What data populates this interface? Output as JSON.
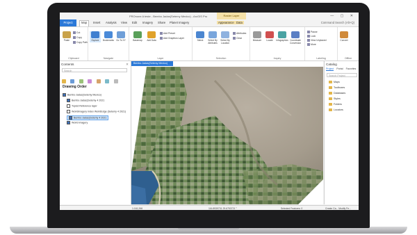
{
  "window": {
    "title": "PROnone A teste - Bembo Jadas(Setemy Mexico) - ArcGIS Pro",
    "contextual_group": "Raster Layer",
    "controls": "— ▢ ✕"
  },
  "ribbon_tabs": {
    "project": "Project",
    "tabs": [
      "Map",
      "Insert",
      "Analysis",
      "View",
      "Edit",
      "Imagery",
      "Share",
      "Planet Imagery",
      "Appearance",
      "Data"
    ],
    "active": "Map",
    "sign_in": "Command Search (Alt+Q)"
  },
  "ribbon": {
    "groups": [
      {
        "label": "Clipboard",
        "buttons": [
          "Paste",
          "Cut",
          "Copy",
          "Copy Path"
        ]
      },
      {
        "label": "Navigate",
        "buttons": [
          "Explore",
          "Bookmarks",
          "Go To XY"
        ]
      },
      {
        "label": "Layer",
        "buttons": [
          "Basemap",
          "Add Data",
          "Add Preset",
          "Add Graphics Layer"
        ]
      },
      {
        "label": "Selection",
        "buttons": [
          "Select",
          "Select By Attributes",
          "Select By Location",
          "Attributes",
          "Clear"
        ]
      },
      {
        "label": "Inquiry",
        "buttons": [
          "Measure",
          "Locate",
          "Infographics",
          "Coordinate Conversion"
        ]
      },
      {
        "label": "Labeling",
        "buttons": [
          "Pause",
          "Lock",
          "View Unplaced",
          "More"
        ]
      },
      {
        "label": "Offline",
        "buttons": [
          "Convert",
          "Download Map"
        ]
      }
    ]
  },
  "contents_pane": {
    "title": "Contents",
    "search_placeholder": "Search",
    "section": "Drawing Order",
    "layers": [
      {
        "name": "Bembo Jadas(Setemy Mexico)",
        "checked": true,
        "selected": false,
        "indent": 0
      },
      {
        "name": "Bembo Jadas(Setemy 4 2021",
        "checked": true,
        "selected": false,
        "indent": 1
      },
      {
        "name": "Topicd Reference layer",
        "checked": false,
        "selected": false,
        "indent": 1
      },
      {
        "name": "Worldimagery Index WorldEdge (Setemy 4 2021)",
        "checked": false,
        "selected": false,
        "indent": 1
      },
      {
        "name": "Bembo Jadas(Setemy 4 2021",
        "checked": true,
        "selected": true,
        "indent": 1
      },
      {
        "name": "World Imagery",
        "checked": true,
        "selected": false,
        "indent": 1
      }
    ]
  },
  "map_view": {
    "tab_label": "Bembo Jadas(Setemy Mexico)"
  },
  "catalog_pane": {
    "title": "Catalog",
    "tabs": [
      "Project",
      "Portal",
      "Favorites"
    ],
    "active_tab": "Project",
    "search_placeholder": "Search Project",
    "items": [
      "Maps",
      "Toolboxes",
      "Databases",
      "Styles",
      "Folders",
      "Locators"
    ]
  },
  "status_bar": {
    "scale": "1:161,266",
    "coordinates": "116.8939731 29.6753721 °",
    "selected": "Selected Features: 0",
    "right": "Create Ca...      Modify Fe..."
  },
  "colors": {
    "accent": "#2b79d8",
    "contextual": "#f5e1a8",
    "folder": "#e3b64a"
  }
}
